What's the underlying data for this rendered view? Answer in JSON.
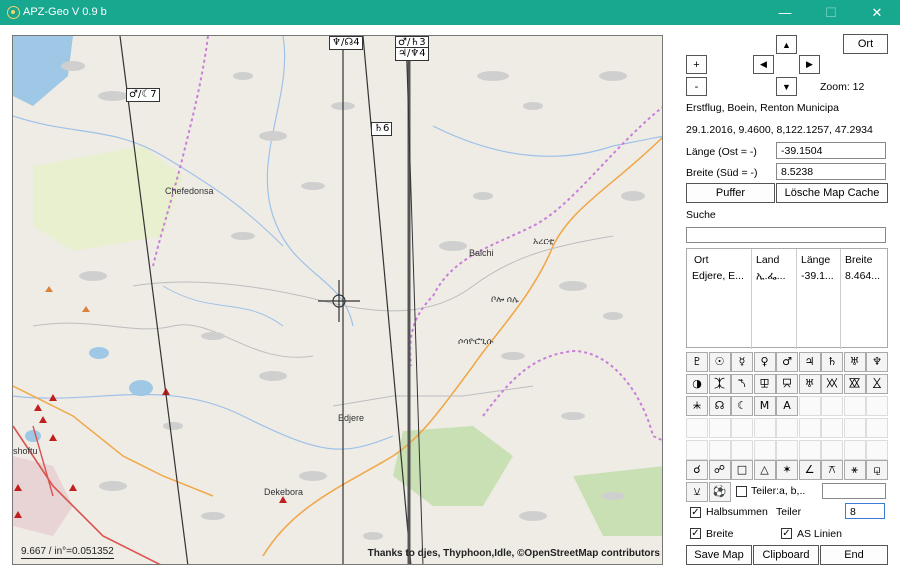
{
  "window": {
    "title": "APZ-Geo V 0.9 b",
    "min_glyph": "—",
    "max_glyph": "☐",
    "close_glyph": "✕"
  },
  "map": {
    "scale_text": "9.667 / in°=0.051352",
    "attribution": "Thanks to djes, Thyphoon,Idle,  ©OpenStreetMap contributors",
    "places": {
      "chefedonsa": "Chefedonsa",
      "balchi": "Balchi",
      "edjere": "Edjere",
      "dekebora": "Dekebora",
      "shoftu": "shoftu",
      "amharic1": "አረርቲ",
      "amharic2": "ቦሎ ሰሌ",
      "amharic3": "ሶሳዮሮጊሱ"
    },
    "planet_labels": {
      "l1": "♂/☾7",
      "l2": "♆/☊4",
      "l3": "♂/♄3",
      "l4": "♃/♆4",
      "l5": "♄6"
    }
  },
  "panel": {
    "ort_button": "Ort",
    "zoom_in": "+",
    "zoom_out": "-",
    "arrow_up": "▲",
    "arrow_down": "▼",
    "arrow_left": "◀",
    "arrow_right": "▶",
    "zoom_label": "Zoom: 12",
    "info_line1": "Erstflug, Boein, Renton Municipa",
    "info_line2": "29.1.2016, 9.4600, 8,122.1257, 47.2934",
    "laenge_label": "Länge  (Ost = -)",
    "laenge_value": "-39.1504",
    "breite_label": "Breite (Süd = -)",
    "breite_value": "8.5238",
    "puffer_button": "Puffer",
    "cache_button": "Lösche Map Cache",
    "suche_label": "Suche",
    "suche_value": "",
    "table": {
      "headers": [
        "Ort",
        "Land",
        "Länge",
        "Breite"
      ],
      "rows": [
        [
          "Edjere, E...",
          "ኢ.ፌ...",
          "-39.1...",
          "8.464..."
        ]
      ]
    },
    "symbols_row1": [
      "♇",
      "☉",
      "☿",
      "♀",
      "♂",
      "♃",
      "♄",
      "♅",
      "♆"
    ],
    "symbols_row2": [
      "◑",
      "⯰",
      "⯲",
      "⯶",
      "⯳",
      "♅",
      "⯵",
      "⯴",
      "⯷"
    ],
    "symbols_row3": [
      "⯸",
      "☊",
      "☾",
      "M",
      "A"
    ],
    "aspects_row": [
      "☌",
      "☍",
      "□",
      "△",
      "✶",
      "∠",
      "⚻",
      "⚹",
      "⚼"
    ],
    "aspects_row2": [
      "⚺",
      "⚽"
    ],
    "teiler_ab_label": "Teiler:a, b,..",
    "teiler_ab_value": "",
    "halbsummen_label": "Halbsummen",
    "teiler_label": "Teiler",
    "teiler_value": "8",
    "breite_chk_label": "Breite",
    "as_linien_label": "AS Linien",
    "save_button": "Save Map",
    "clipboard_button": "Clipboard",
    "end_button": "End"
  },
  "colors": {
    "titlebar": "#17a88f",
    "map_bg": "#efece6",
    "water": "#9fc8e6",
    "green": "#c9e0b4",
    "boundary": "#c97fd8",
    "road": "#f0a84a",
    "river": "#7fb4e6"
  }
}
